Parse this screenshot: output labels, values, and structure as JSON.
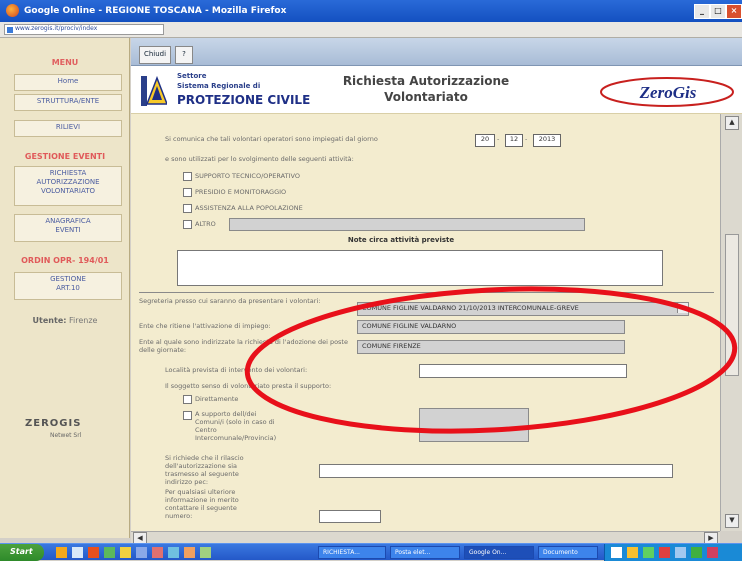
{
  "window": {
    "title": "Google Online - REGIONE TOSCANA - Mozilla Firefox",
    "address": "www.zerogis.it/prociv/index"
  },
  "sidebar": {
    "menu_title": "MENU",
    "home": "Home",
    "strutture": "STRUTTURA/ENTE",
    "rilievi": "RILIEVI",
    "events_title": "GESTIONE EVENTI",
    "richiesta_btn": [
      "RICHIESTA",
      "AUTORIZZAZIONE",
      "VOLONTARIATO"
    ],
    "anagrafica_btn": [
      "ANAGRAFICA",
      "EVENTI"
    ],
    "ord_title": "ORDIN OPR- 194/01",
    "gestione_btn": [
      "GESTIONE",
      "ART.10"
    ],
    "utente_label": "Utente:",
    "utente_value": "Firenze",
    "zerogis_small": "ZEROGIS",
    "zerogis_small_sub": "Netwet Srl"
  },
  "topbar": {
    "btn1": "Chiudi",
    "btn2": "?"
  },
  "header": {
    "settore": "Settore",
    "sistema": "Sistema Regionale di",
    "protezione": "PROTEZIONE CIVILE",
    "title_line1": "Richiesta Autorizzazione",
    "title_line2": "Volontariato",
    "zerogis": "ZeroGis"
  },
  "form": {
    "intro_text": "Si comunica che tali volontari operatori sono impiegati dal giorno",
    "date_day": "20",
    "date_month": "12",
    "date_year": "2013",
    "utilizzati_text": "e sono utilizzati per lo svolgimento delle seguenti attività:",
    "activities": [
      "SUPPORTO TECNICO/OPERATIVO",
      "PRESIDIO E MONITORAGGIO",
      "ASSISTENZA ALLA POPOLAZIONE",
      "ALTRO"
    ],
    "note_title": "Note circa attività previste",
    "segreteria_label": "Segreteria presso cui saranno da presentare i volontari:",
    "segreteria_value": "COMUNE FIGLINE VALDARNO 21/10/2013 INTERCOMUNALE-GREVE",
    "ente_impiego_label": "Ente che ritiene l'attivazione di impiego:",
    "ente_impiego_value": "COMUNE FIGLINE VALDARNO",
    "ente_richiesta_label": "Ente al quale sono indirizzate la richiesta di l'adozione dei poste delle giornate:",
    "ente_richiesta_value": "COMUNE FIRENZE",
    "localita_label": "Località prevista di intervento dei volontari:",
    "soggetto_label": "Il soggetto senso di volontariato presta il supporto:",
    "opt_direttamente": "Direttamente",
    "opt_supporto": "A supporto dell/dei Comuni/i (solo in caso di Centro Intercomunale/Provincia)",
    "rilascio_label": "Si richiede che il rilascio dell'autorizzazione sia trasmesso al seguente indirizzo pec:",
    "contatti_label": "Per qualsiasi ulteriore informazione in merito contattare il seguente numero:"
  },
  "taskbar": {
    "start": "Start",
    "tasks": [
      "RICHIESTA...",
      "Posta elet...",
      "Google On...",
      "Documento"
    ]
  },
  "colors": {
    "accent": "#1e2f86",
    "highlight": "#e8101a",
    "form_bg": "#f3eccf",
    "sidebar_bg": "#ede5c9"
  }
}
